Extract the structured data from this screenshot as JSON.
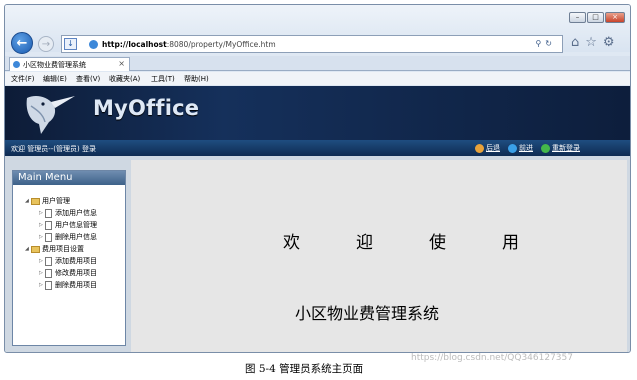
{
  "browser": {
    "url_host": "http://localhost",
    "url_rest": ":8080/property/MyOffice.htm",
    "tab_title": "小区物业费管理系统",
    "tab_close": "×",
    "window_controls": {
      "minimize": "–",
      "maximize": "□",
      "close": "×"
    },
    "menu": [
      "文件(F)",
      "编辑(E)",
      "查看(V)",
      "收藏夹(A)",
      "工具(T)",
      "帮助(H)"
    ]
  },
  "header": {
    "brand": "MyOffice"
  },
  "statusbar": {
    "welcome": "欢迎 管理员--(管理员) 登录",
    "back": "后退",
    "forward": "前进",
    "relogin": "重新登录"
  },
  "sidebar": {
    "title": "Main Menu",
    "groups": [
      {
        "label": "用户管理",
        "items": [
          "添加用户信息",
          "用户信息管理",
          "删除用户信息"
        ]
      },
      {
        "label": "费用项目设置",
        "items": [
          "添加费用项目",
          "修改费用项目",
          "删除费用项目"
        ]
      }
    ]
  },
  "main": {
    "welcome": "欢迎使用",
    "system_name": "小区物业费管理系统"
  },
  "caption": "图 5-4 管理员系统主页面",
  "watermark": "https://blog.csdn.net/QQ346127357"
}
